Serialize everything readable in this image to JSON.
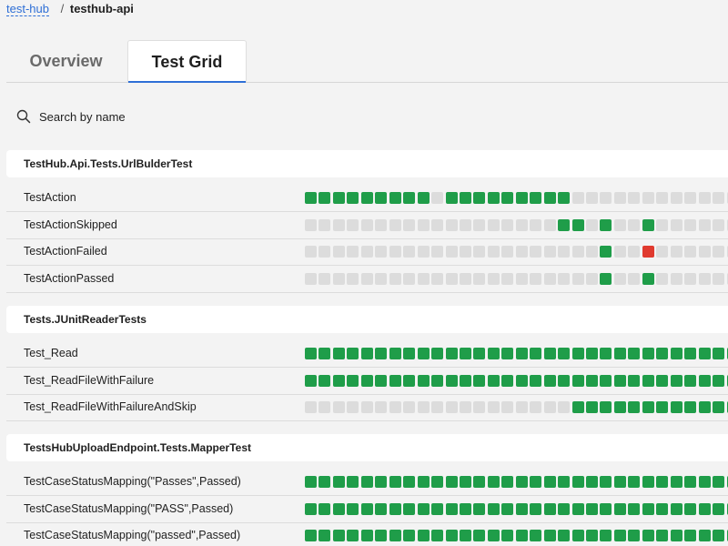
{
  "breadcrumb": {
    "parent": "test-hub",
    "separator": "/",
    "current": "testhub-api"
  },
  "tabs": [
    {
      "label": "Overview",
      "active": false
    },
    {
      "label": "Test Grid",
      "active": true
    }
  ],
  "search": {
    "placeholder": "Search by name",
    "icon": "search-icon"
  },
  "colors": {
    "pass": "#1f9d49",
    "fail": "#e03a2f",
    "empty": "#dcdcdc",
    "link": "#2e6fd6"
  },
  "legend": {
    "P": "pass",
    "F": "fail",
    ".": "no run"
  },
  "groups": [
    {
      "name": "TestHub.Api.Tests.UrlBulderTest",
      "tests": [
        {
          "name": "TestAction",
          "runs": "PPPPPPPPP.PPPPPPPPP..............."
        },
        {
          "name": "TestActionSkipped",
          "runs": "..................PP.P..P.........."
        },
        {
          "name": "TestActionFailed",
          "runs": ".....................P..F.........."
        },
        {
          "name": "TestActionPassed",
          "runs": ".....................P..P.........."
        }
      ]
    },
    {
      "name": "Tests.JUnitReaderTests",
      "tests": [
        {
          "name": "Test_Read",
          "runs": "PPPPPPPPPPPPPPPPPPPPPPPPPPPPPPPPPP"
        },
        {
          "name": "Test_ReadFileWithFailure",
          "runs": "PPPPPPPPPPPPPPPPPPPPPPPPPPPPPPPPPP"
        },
        {
          "name": "Test_ReadFileWithFailureAndSkip",
          "runs": "...................PPPPPPPPPPPPPPPP"
        }
      ]
    },
    {
      "name": "TestsHubUploadEndpoint.Tests.MapperTest",
      "tests": [
        {
          "name": "TestCaseStatusMapping(\"Passes\",Passed)",
          "runs": "PPPPPPPPPPPPPPPPPPPPPPPPPPPPPPPPPP"
        },
        {
          "name": "TestCaseStatusMapping(\"PASS\",Passed)",
          "runs": "PPPPPPPPPPPPPPPPPPPPPPPPPPPPPPPPPP"
        },
        {
          "name": "TestCaseStatusMapping(\"passed\",Passed)",
          "runs": "PPPPPPPPPPPPPPPPPPPPPPPPPPPPPPPPPP"
        }
      ]
    }
  ]
}
